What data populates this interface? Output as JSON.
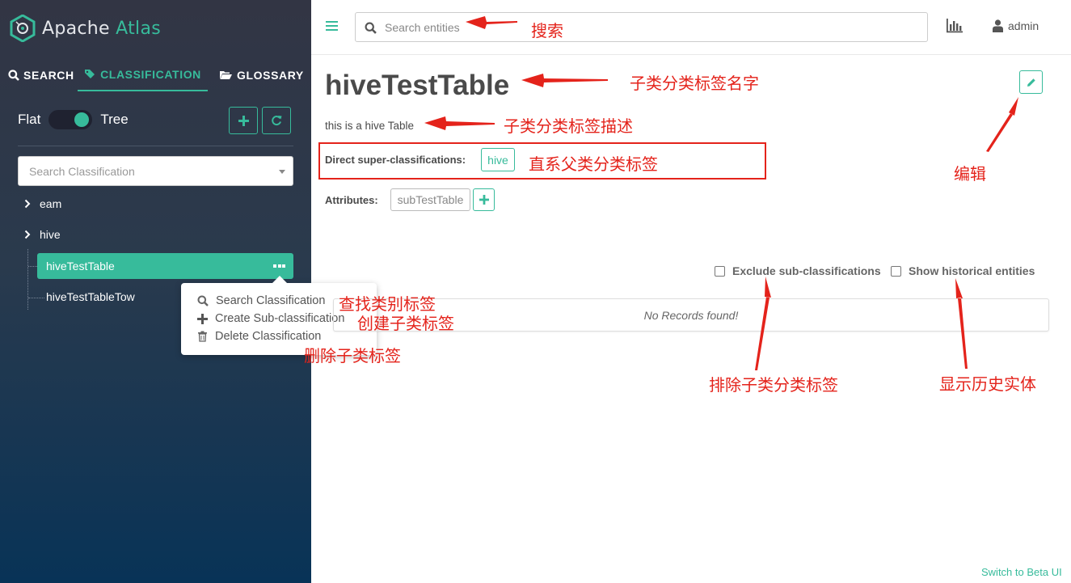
{
  "app": {
    "brand": {
      "name_first": "Apache",
      "name_second": "Atlas"
    }
  },
  "sidebar": {
    "tabs": {
      "search": "SEARCH",
      "classification": "CLASSIFICATION",
      "glossary": "GLOSSARY"
    },
    "toggle": {
      "left": "Flat",
      "right": "Tree"
    },
    "class_search_placeholder": "Search Classification",
    "tree": [
      {
        "label": "eam"
      },
      {
        "label": "hive"
      },
      {
        "label": "hiveTestTable",
        "selected": true
      },
      {
        "label": "hiveTestTableTow"
      }
    ],
    "popover": {
      "search": "Search Classification",
      "create": "Create Sub-classification",
      "delete": "Delete Classification"
    }
  },
  "header": {
    "entity_search_placeholder": "Search entities",
    "user": "admin"
  },
  "detail": {
    "title": "hiveTestTable",
    "description": "this is a hive Table",
    "super_label": "Direct super-classifications:",
    "super_tag": "hive",
    "attr_label": "Attributes:",
    "attr_tag": "subTestTable",
    "exclude_label": "Exclude sub-classifications",
    "historical_label": "Show historical entities",
    "no_records": "No Records found!",
    "beta_link": "Switch to Beta UI"
  },
  "annotations": {
    "search": "搜索",
    "name": "子类分类标签名字",
    "description": "子类分类标签描述",
    "super": "直系父类分类标签",
    "edit": "编辑",
    "search_class": "查找类别标签",
    "create_sub": "创建子类标签",
    "delete_sub": "删除子类标签",
    "exclude": "排除子类分类标签",
    "historical": "显示历史实体"
  },
  "colors": {
    "accent": "#37bb9b",
    "annotation": "#e4231b"
  }
}
